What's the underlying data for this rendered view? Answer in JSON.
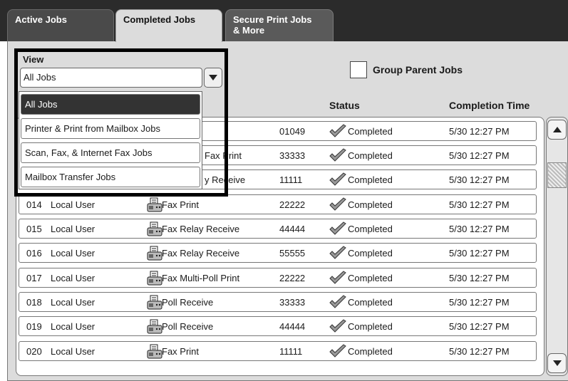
{
  "tabs": [
    {
      "label": "Active Jobs"
    },
    {
      "label": "Completed Jobs"
    },
    {
      "label_line1": "Secure Print Jobs",
      "label_line2": "& More"
    }
  ],
  "view": {
    "label": "View",
    "selected": "All Jobs",
    "options": [
      "All Jobs",
      "Printer & Print from Mailbox Jobs",
      "Scan, Fax, & Internet Fax Jobs",
      "Mailbox Transfer Jobs"
    ]
  },
  "group_parent": {
    "label": "Group Parent Jobs",
    "checked": false
  },
  "columns": {
    "status": "Status",
    "completion_time": "Completion Time"
  },
  "partial_rows": [
    {
      "type_tail": "",
      "number": "01049",
      "status": "Completed",
      "time": "5/30 12:27 PM"
    },
    {
      "type_tail": "Fax Print",
      "number": "33333",
      "status": "Completed",
      "time": "5/30 12:27 PM"
    },
    {
      "type_tail": "y Receive",
      "number": "11111",
      "status": "Completed",
      "time": "5/30 12:27 PM"
    }
  ],
  "rows": [
    {
      "id": "014",
      "user": "Local User",
      "type": "Fax Print",
      "number": "22222",
      "status": "Completed",
      "time": "5/30 12:27 PM"
    },
    {
      "id": "015",
      "user": "Local User",
      "type": "Fax Relay Receive",
      "number": "44444",
      "status": "Completed",
      "time": "5/30 12:27 PM"
    },
    {
      "id": "016",
      "user": "Local User",
      "type": "Fax Relay Receive",
      "number": "55555",
      "status": "Completed",
      "time": "5/30 12:27 PM"
    },
    {
      "id": "017",
      "user": "Local User",
      "type": "Fax Multi-Poll Print",
      "number": "22222",
      "status": "Completed",
      "time": "5/30 12:27 PM"
    },
    {
      "id": "018",
      "user": "Local User",
      "type": "Poll Receive",
      "number": "33333",
      "status": "Completed",
      "time": "5/30 12:27 PM"
    },
    {
      "id": "019",
      "user": "Local User",
      "type": "Poll Receive",
      "number": "44444",
      "status": "Completed",
      "time": "5/30 12:27 PM"
    },
    {
      "id": "020",
      "user": "Local User",
      "type": "Fax Print",
      "number": "11111",
      "status": "Completed",
      "time": "5/30 12:27 PM"
    }
  ],
  "icons": {
    "job_type": "fax-machine-icon",
    "status": "checkmark-icon",
    "dropdown": "chevron-down-icon",
    "scroll_up": "arrow-up-icon",
    "scroll_down": "arrow-down-icon"
  }
}
